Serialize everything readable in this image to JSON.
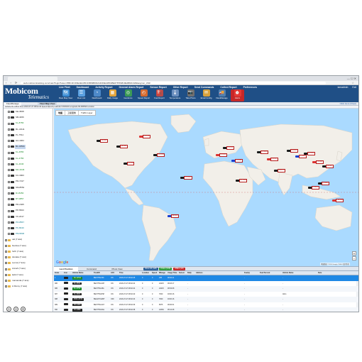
{
  "browser": {
    "url": "web.mobicomtracking.com/main?login?token=B5F4FCF6E4E1D8C33B09B0D2AD3DEA9564BE678784819E2B82CA8&lang=en_US#",
    "window_controls": "—  ☐  ✕"
  },
  "app": {
    "logo_main": "Mobicom",
    "logo_sub": "Telematics",
    "top_menu": [
      "Live Fleet",
      "Dashboard",
      "Activity Report",
      "General Alarm Report",
      "Sensor Report",
      "Other Report",
      "Send Commands",
      "Collect Report",
      "Preferences"
    ],
    "user": "iamadmin",
    "exit_label": "Exit",
    "toolbar": [
      {
        "label": "Fleet Map View",
        "icon": "map-icon",
        "color": "#3d8fd6"
      },
      {
        "label": "Fleet List",
        "icon": "list-icon",
        "color": "#5aa0e0"
      },
      {
        "label": "Dashboard",
        "icon": "dashboard-icon",
        "color": "#4d89c9"
      },
      {
        "label": "Daily Usage",
        "icon": "calendar-icon",
        "color": "#e3a43b"
      },
      {
        "label": "Geofence",
        "icon": "geofence-icon",
        "color": "#3c9a56"
      },
      {
        "label": "Speed Report",
        "icon": "speedometer-icon",
        "color": "#d66a2f"
      },
      {
        "label": "Fuel Report",
        "icon": "fuel-icon",
        "color": "#b94a48"
      },
      {
        "label": "Temperature",
        "icon": "thermometer-icon",
        "color": "#6b8fbf"
      },
      {
        "label": "Take Photo",
        "icon": "camera-icon",
        "color": "#6f6f6f"
      },
      {
        "label": "Email Config",
        "icon": "mail-icon",
        "color": "#d9a23c"
      },
      {
        "label": "FleetManage",
        "icon": "truck-icon",
        "color": "#4f7fb0"
      },
      {
        "label": "Alarm",
        "icon": "alarm-icon",
        "color": "#e53935"
      }
    ]
  },
  "subbar": {
    "left_tab": "FleetManage",
    "right_tab": "Fleet Map View",
    "right_link": "Click Here (Fleet)"
  },
  "status_line": "Vehicle  RL J2511   Time  2016-07-27 08:02:45   Speed  0(km/h)   Latitude  9.536400   Longitude  99.486599   Location",
  "tree": [
    {
      "type": "vehicle",
      "label": "KE-4508",
      "color": "default"
    },
    {
      "type": "vehicle",
      "label": "SB-4066",
      "color": "default"
    },
    {
      "type": "vehicle",
      "label": "KL-8756",
      "color": "green"
    },
    {
      "type": "vehicle",
      "label": "RL-J2111",
      "color": "default"
    },
    {
      "type": "vehicle",
      "label": "PL-7511",
      "color": "default"
    },
    {
      "type": "vehicle",
      "label": "HA-4064",
      "color": "default"
    },
    {
      "type": "vehicle",
      "label": "RL-J2511",
      "color": "default",
      "selected": true
    },
    {
      "type": "vehicle",
      "label": "KL-4556",
      "color": "green"
    },
    {
      "type": "vehicle",
      "label": "KL-4756",
      "color": "green"
    },
    {
      "type": "vehicle",
      "label": "KL-4646",
      "color": "green"
    },
    {
      "type": "vehicle",
      "label": "MC-4046",
      "color": "green"
    },
    {
      "type": "vehicle",
      "label": "KC-3903",
      "color": "default"
    },
    {
      "type": "vehicle",
      "label": "PD-7217",
      "color": "default"
    },
    {
      "type": "vehicle",
      "label": "SM-8552",
      "color": "default"
    },
    {
      "type": "vehicle",
      "label": "RJ-8450",
      "color": "green"
    },
    {
      "type": "vehicle",
      "label": "RT-3857",
      "color": "green"
    },
    {
      "type": "vehicle",
      "label": "PD-2405",
      "color": "default"
    },
    {
      "type": "vehicle",
      "label": "PP-5503",
      "color": "default"
    },
    {
      "type": "vehicle",
      "label": "VK-2017",
      "color": "default"
    },
    {
      "type": "vehicle",
      "label": "PO-8567",
      "color": "cyan"
    },
    {
      "type": "vehicle",
      "label": "PK-8040",
      "color": "cyan"
    },
    {
      "type": "vehicle",
      "label": "PM-5836",
      "color": "cyan"
    },
    {
      "type": "folder",
      "label": "ual  (7 ácé)"
    },
    {
      "type": "folder",
      "label": "bienlua  (7 ácé)"
    },
    {
      "type": "folder",
      "label": "furth  (7 ácé)"
    },
    {
      "type": "folder",
      "label": "dunaka  (7 ácé)"
    },
    {
      "type": "folder",
      "label": "Lenna  (7 ácé)"
    },
    {
      "type": "folder",
      "label": "Annah  (7 ácé)"
    },
    {
      "type": "folder",
      "label": "ladd  (7 ácé)"
    },
    {
      "type": "folder",
      "label": "mamanda  (7 ácé)"
    },
    {
      "type": "folder",
      "label": "Ll Rémy  (7 ácé)"
    }
  ],
  "map": {
    "tabs": [
      "地图",
      "卫星图像",
      "Traffic Layer"
    ],
    "attribution": "地图数据 ©2016 Google, INEGI  使用条款",
    "google_letters": [
      "G",
      "o",
      "o",
      "g",
      "l",
      "e"
    ],
    "zoom_in": "+",
    "zoom_out": "−",
    "water_color": "#aadaff",
    "land_color": "#f2efe9",
    "markers": [
      {
        "label": "KE-4508",
        "kind": "normal"
      },
      {
        "label": "SB-4066",
        "kind": "normal"
      },
      {
        "label": "KL-8756",
        "kind": "warn"
      },
      {
        "label": "RL-J2111",
        "kind": "normal"
      },
      {
        "label": "PL-7511",
        "kind": "normal"
      },
      {
        "label": "HA-4064",
        "kind": "blue"
      },
      {
        "label": "RL-J2511",
        "kind": "normal"
      },
      {
        "label": "KL-4556",
        "kind": "warn"
      },
      {
        "label": "KL-4756",
        "kind": "normal"
      },
      {
        "label": "KL-4646",
        "kind": "blue"
      },
      {
        "label": "MC-4046",
        "kind": "normal"
      },
      {
        "label": "KC-3903",
        "kind": "normal"
      },
      {
        "label": "PD-7217",
        "kind": "warn"
      },
      {
        "label": "SM-8552",
        "kind": "normal"
      },
      {
        "label": "RJ-8450",
        "kind": "normal"
      },
      {
        "label": "RT-3857",
        "kind": "blue"
      },
      {
        "label": "PD-2405",
        "kind": "normal"
      },
      {
        "label": "PP-5503",
        "kind": "warn"
      },
      {
        "label": "VK-2017",
        "kind": "normal"
      },
      {
        "label": "PO-8567",
        "kind": "normal"
      },
      {
        "label": "PK-8040",
        "kind": "normal"
      },
      {
        "label": "PM-5836",
        "kind": "warn"
      }
    ]
  },
  "grid": {
    "tabs": [
      "Last Position",
      "Command",
      "Photo View"
    ],
    "pill_all": "Show All (128)",
    "pill_online": "Online (108)",
    "pill_offline": "Offline (20)",
    "columns": [
      "Index",
      "Icon",
      "Vehicle Name",
      "TrackID",
      "ACC",
      "Time",
      "Location",
      "Speed",
      "Mileage",
      "Usage Time",
      "Sensor",
      "Daily",
      "Address",
      "Fuel(L)",
      "Fuel Percent",
      "Vehicle Name",
      "Note"
    ],
    "rows": [
      [
        "1",
        "",
        "RL-J2511",
        "BE3775G700",
        "ON",
        "2016-07-27 08:02:45",
        "0",
        "0",
        "245",
        "00:02:11",
        "",
        "-",
        "",
        "-",
        "",
        "-",
        ""
      ],
      [
        "386",
        "",
        "KL-4556",
        "BE3775G4CH",
        "ON",
        "2016-07-27 08:02:44",
        "0",
        "0",
        "24215",
        "06:03:17",
        "",
        "-",
        "",
        "-",
        "",
        "-",
        ""
      ],
      [
        "386",
        "",
        "KL-4756",
        "BE3775G45A",
        "ON",
        "2016-07-27 08:02:44",
        "0",
        "0",
        "24215",
        "06:54:08",
        "",
        "-",
        "",
        "-",
        "",
        "-",
        ""
      ],
      [
        "387",
        "",
        "KL-3903",
        "BE3775G8HZ",
        "ON",
        "2016-07-27 08:02:40",
        "0",
        "0",
        "7840",
        "03:00:16",
        "",
        "-",
        "",
        "-",
        "",
        "Afsin",
        ""
      ],
      [
        "388",
        "",
        "PDM  -8730",
        "BEGJ8YGZRT",
        "OFF",
        "2016-07-27 08:02:43",
        "0",
        "0",
        "7840",
        "03:00:16",
        "",
        "-",
        "",
        "-",
        "",
        "-",
        ""
      ],
      [
        "389",
        "",
        "PD-4450",
        "BE3775G4GT",
        "ON",
        "2016-07-27 08:02:39",
        "0",
        "0",
        "8975",
        "06:06:31",
        "",
        "-",
        "",
        "-",
        "",
        "-",
        ""
      ],
      [
        "390",
        "",
        "PO-4880",
        "BE3775G9AG",
        "ON",
        "2016-07-27 08:02:38",
        "0",
        "0",
        "12084",
        "05:12:48",
        "",
        "-",
        "",
        "-",
        "",
        "-",
        ""
      ]
    ],
    "row_tag_colors": [
      "green",
      "black",
      "green",
      "black",
      "black",
      "black",
      "black"
    ]
  }
}
